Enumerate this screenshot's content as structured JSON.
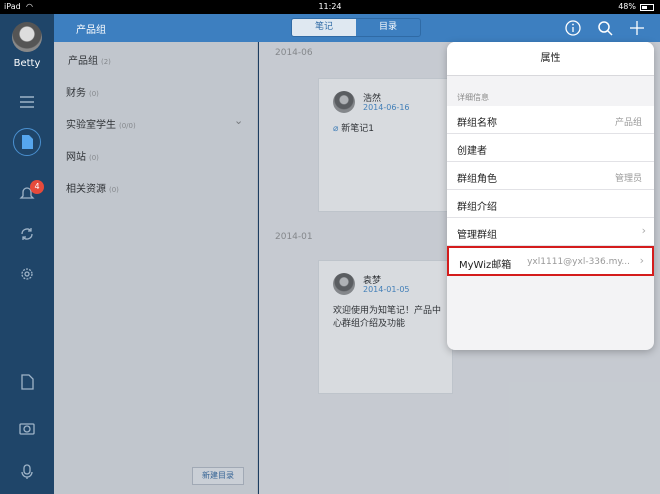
{
  "status_bar": {
    "device": "iPad",
    "time": "11:24",
    "battery": "48%"
  },
  "user": {
    "name": "Betty"
  },
  "rail": {
    "notification_badge": "4"
  },
  "header": {
    "group_title": "产品组",
    "tab_notes": "笔记",
    "tab_catalog": "目录"
  },
  "sidebar": {
    "items": [
      {
        "label": "产品组",
        "count": "(2)"
      },
      {
        "label": "财务",
        "count": "(0)"
      },
      {
        "label": "实验室学生",
        "count": "(0/0)"
      },
      {
        "label": "网站",
        "count": "(0)"
      },
      {
        "label": "相关资源",
        "count": "(0)"
      }
    ],
    "new_catalog_button": "新建目录"
  },
  "notes": {
    "sections": [
      {
        "date": "2014-06",
        "author": "浩然",
        "note_date": "2014-06-16",
        "title": "新笔记1"
      },
      {
        "date": "2014-01",
        "author": "袁梦",
        "note_date": "2014-01-05",
        "body": "欢迎使用为知笔记！产品中心群组介绍及功能"
      }
    ]
  },
  "popover": {
    "title": "属性",
    "section_label": "详细信息",
    "rows": [
      {
        "label": "群组名称",
        "value": "产品组"
      },
      {
        "label": "创建者",
        "value": ""
      },
      {
        "label": "群组角色",
        "value": "管理员"
      },
      {
        "label": "群组介绍",
        "value": ""
      },
      {
        "label": "管理群组",
        "value": ""
      },
      {
        "label": "MyWiz邮箱",
        "value": "yxl1111@yxl-336.my..."
      }
    ]
  },
  "colors": {
    "accent": "#3d7fc0",
    "rail": "#1f4569",
    "highlight": "#d41c1c",
    "badge": "#e64a3b"
  }
}
